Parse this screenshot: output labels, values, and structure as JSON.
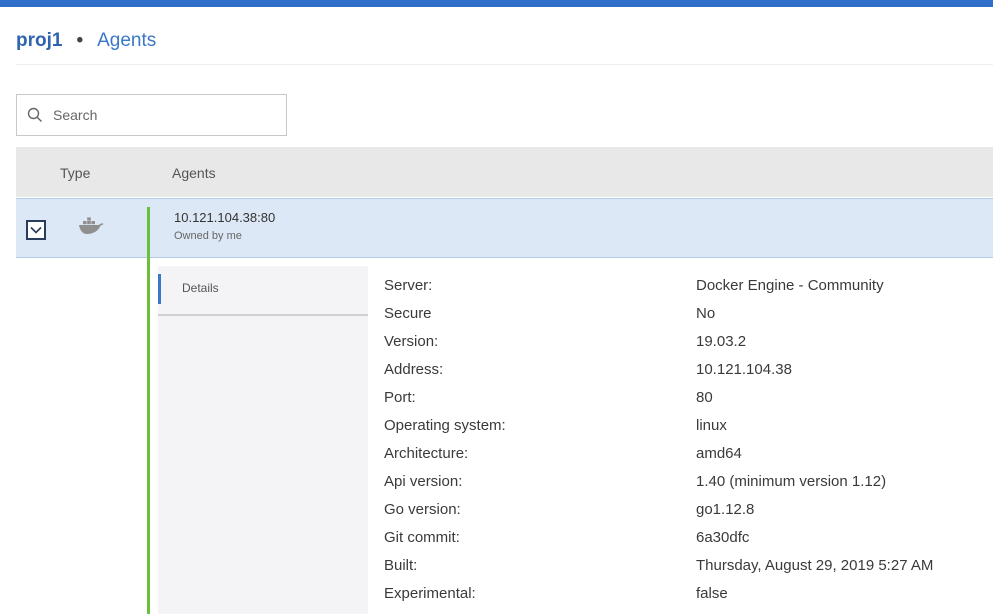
{
  "breadcrumb": {
    "project": "proj1",
    "separator": "•",
    "page": "Agents"
  },
  "search": {
    "placeholder": "Search",
    "value": ""
  },
  "table": {
    "columns": [
      "Type",
      "Agents"
    ],
    "rows": [
      {
        "type_icon": "docker-whale-icon",
        "name": "10.121.104.38:80",
        "owner": "Owned by me",
        "expanded": true
      }
    ]
  },
  "details": {
    "tab_label": "Details",
    "properties": [
      {
        "key": "Server:",
        "value": "Docker Engine - Community"
      },
      {
        "key": "Secure",
        "value": "No"
      },
      {
        "key": "Version:",
        "value": "19.03.2"
      },
      {
        "key": "Address:",
        "value": "10.121.104.38"
      },
      {
        "key": "Port:",
        "value": "80"
      },
      {
        "key": "Operating system:",
        "value": "linux"
      },
      {
        "key": "Architecture:",
        "value": "amd64"
      },
      {
        "key": "Api version:",
        "value": "1.40 (minimum version 1.12)"
      },
      {
        "key": "Go version:",
        "value": "go1.12.8"
      },
      {
        "key": "Git commit:",
        "value": "6a30dfc"
      },
      {
        "key": "Built:",
        "value": "Thursday, August 29, 2019 5:27 AM"
      },
      {
        "key": "Experimental:",
        "value": "false"
      }
    ]
  },
  "colors": {
    "topbar": "#2f6fc9",
    "link": "#3a6fba",
    "selected_row": "#dde8f6",
    "expanded_line": "#6cbf3b",
    "tab_indicator": "#3b78c8"
  }
}
